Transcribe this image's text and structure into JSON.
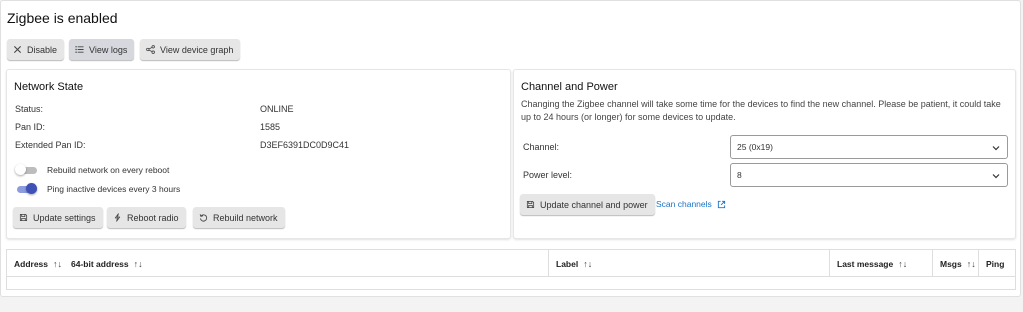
{
  "page": {
    "title": "Zigbee is enabled"
  },
  "toolbar": {
    "disable_label": "Disable",
    "view_logs_label": "View logs",
    "view_graph_label": "View device graph"
  },
  "network_state": {
    "title": "Network State",
    "rows": [
      {
        "label": "Status:",
        "value": "ONLINE"
      },
      {
        "label": "Pan ID:",
        "value": "1585"
      },
      {
        "label": "Extended Pan ID:",
        "value": "D3EF6391DC0D9C41"
      }
    ],
    "toggles": [
      {
        "label": "Rebuild network on every reboot",
        "checked": false
      },
      {
        "label": "Ping inactive devices every 3 hours",
        "checked": true
      }
    ],
    "buttons": {
      "update_settings": "Update settings",
      "reboot_radio": "Reboot radio",
      "rebuild_network": "Rebuild network"
    }
  },
  "channel_power": {
    "title": "Channel and Power",
    "description": "Changing the Zigbee channel will take some time for the devices to find the new channel. Please be patient, it could take up to 24 hours (or longer) for some devices to update.",
    "channel_label": "Channel:",
    "channel_value": "25 (0x19)",
    "power_label": "Power level:",
    "power_value": "8",
    "update_button": "Update channel and power",
    "scan_link": "Scan channels"
  },
  "table": {
    "columns": [
      {
        "label": "Address",
        "sortable": true
      },
      {
        "label": "64-bit address",
        "sortable": true
      },
      {
        "label": "Label",
        "sortable": true
      },
      {
        "label": "Last message",
        "sortable": true
      },
      {
        "label": "Msgs",
        "sortable": true
      },
      {
        "label": "Ping",
        "sortable": false
      }
    ],
    "sort_glyph": "↑↓"
  },
  "colors": {
    "accent": "#3f51b5",
    "toggle_on_track": "#8c9cde",
    "toggle_off_thumb": "#ffffff",
    "link": "#1a73c8",
    "button_bg": "#e6e6e6"
  }
}
